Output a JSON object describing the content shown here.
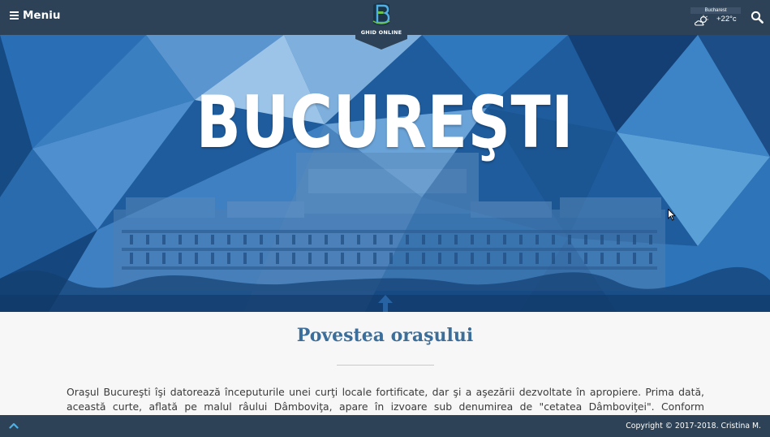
{
  "header": {
    "menu_label": "Meniu",
    "logo_text": "GHID ONLINE",
    "weather": {
      "city": "Bucharest",
      "temperature": "+22°c",
      "icon": "partly-cloudy-icon"
    },
    "search_icon": "search-icon"
  },
  "hero": {
    "title": "BUCUREŞTI"
  },
  "main": {
    "section_title": "Povestea oraşului",
    "story_text": "Oraşul Bucureşti îşi datorează începuturile unei curţi locale fortificate, dar şi a aşezării dezvoltate în apropiere. Prima dată, această curte, aflată pe malul râului Dâmboviţa, apare în izvoare sub denumirea de \"cetatea Dâmboviţei\". Conform cercetărilor arheologice şi a"
  },
  "footer": {
    "copyright": "Copyright © 2017-2018. Cristina M.",
    "scroll_top_icon": "chevron-up-icon"
  },
  "colors": {
    "nav": "#2d4256",
    "title_blue": "#3b6e9a",
    "hero_blue": "#1f5c9d",
    "hero_dark": "#143f74"
  }
}
